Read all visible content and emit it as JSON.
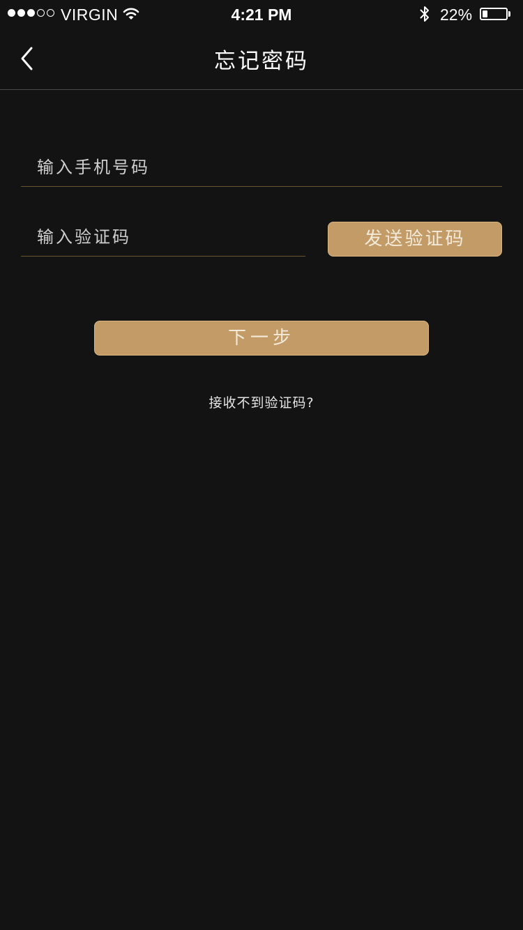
{
  "status_bar": {
    "carrier": "VIRGIN",
    "time": "4:21 PM",
    "battery_percent": "22%",
    "battery_level": 0.22,
    "signal_bars_filled": 3,
    "signal_bars_total": 5,
    "icons": [
      "wifi-icon",
      "bluetooth-icon",
      "battery-icon"
    ]
  },
  "nav": {
    "title": "忘记密码",
    "back_icon": "chevron-left-icon"
  },
  "form": {
    "phone_placeholder": "输入手机号码",
    "code_placeholder": "输入验证码",
    "send_code_label": "发送验证码",
    "next_label": "下一步",
    "help_link": "接收不到验证码?"
  },
  "colors": {
    "background": "#131313",
    "accent_gold": "#c39b67",
    "divider": "#6b5531"
  }
}
